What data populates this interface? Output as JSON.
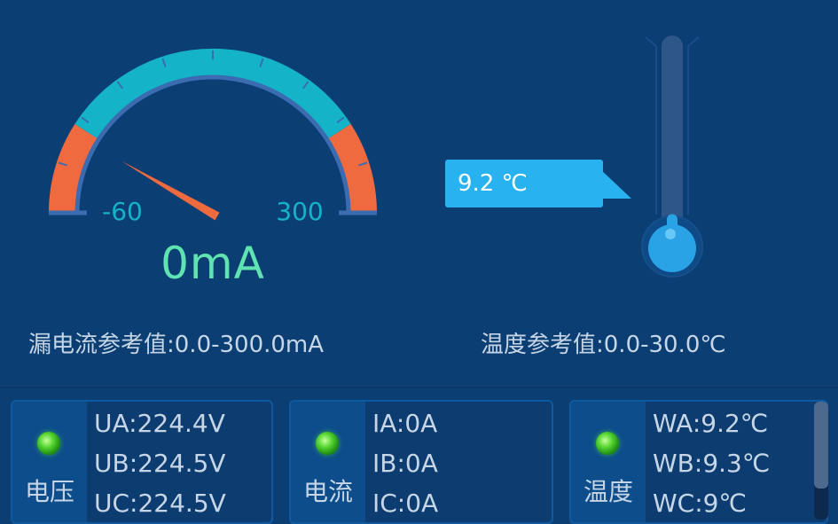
{
  "gauge": {
    "value_label": "0mA",
    "min_label": "-60",
    "max_label": "300",
    "min": -60,
    "max": 300,
    "value": 0,
    "colors": {
      "normal": "#14b3c8",
      "warning": "#f06a3f",
      "needle": "#f06a3f",
      "inner_ring": "#3b6bb0"
    }
  },
  "leak_reference": "漏电流参考值:0.0-300.0mA",
  "temperature": {
    "bubble_label": "9.2 ℃",
    "value": 9.2,
    "reference": "温度参考值:0.0-30.0℃",
    "colors": {
      "bubble": "#28b2ef",
      "bulb": "#2aa3e6"
    }
  },
  "cards": {
    "voltage": {
      "label": "电压",
      "lines": [
        "UA:224.4V",
        "UB:224.5V",
        "UC:224.5V"
      ],
      "led_color": "#55d632"
    },
    "current": {
      "label": "电流",
      "lines": [
        "IA:0A",
        "IB:0A",
        "IC:0A"
      ],
      "led_color": "#55d632"
    },
    "temperature": {
      "label": "温度",
      "lines": [
        "WA:9.2℃",
        "WB:9.3℃",
        "WC:9℃"
      ],
      "led_color": "#55d632"
    }
  }
}
